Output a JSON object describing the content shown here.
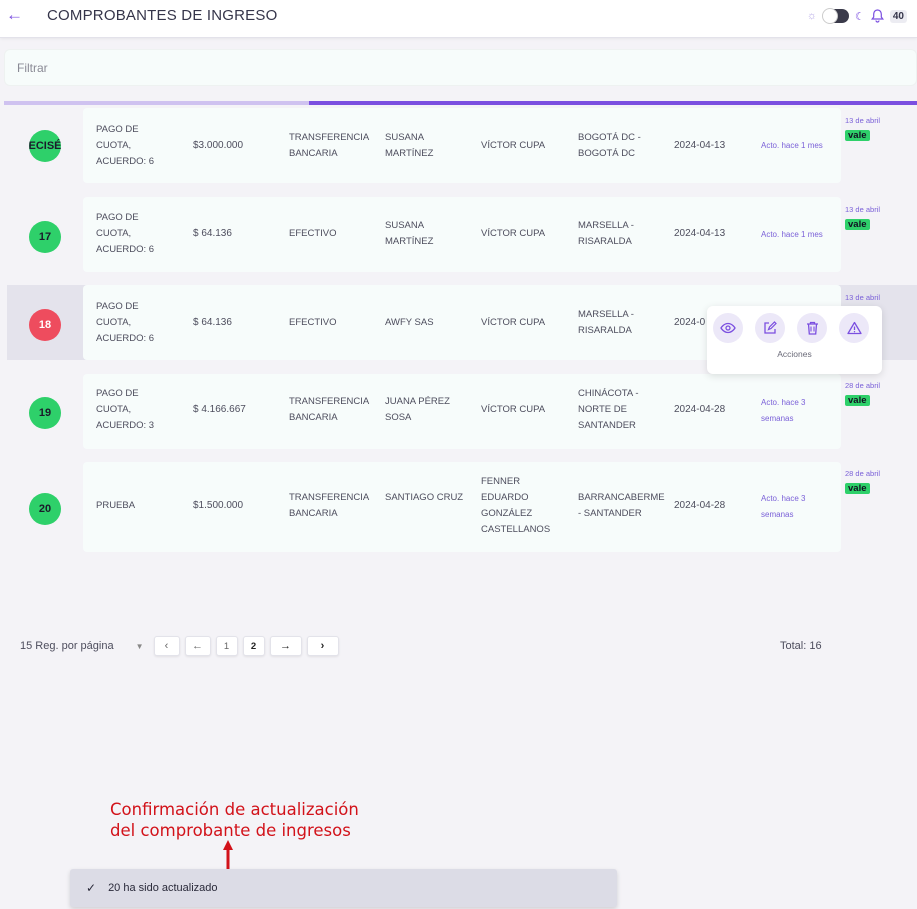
{
  "header": {
    "title": "COMPROBANTES DE INGRESO",
    "notifications": "40",
    "icons": [
      "back-arrow-icon",
      "sun-icon",
      "theme-toggle",
      "moon-icon",
      "bell-icon"
    ]
  },
  "filter": {
    "placeholder": "Filtrar"
  },
  "progress": {
    "value_percent": 67
  },
  "rows": [
    {
      "id": "ECISÉ",
      "status_color": "#2ed06a",
      "concept": "PAGO DE CUOTA, ACUERDO: 6",
      "amount": "$3.000.000",
      "method": "TRANSFERENCIA BANCARIA",
      "client": "SUSANA MARTÍNEZ",
      "collector": "VÍCTOR CUPA",
      "city": "BOGOTÁ DC - BOGOTÁ DC",
      "date": "2024-04-13",
      "updated": "Acto. hace 1 mes",
      "side_date": "13 de abril",
      "tag": "vale"
    },
    {
      "id": "17",
      "status_color": "#2ed06a",
      "concept": "PAGO DE CUOTA, ACUERDO: 6",
      "amount": "$ 64.136",
      "method": "EFECTIVO",
      "client": "SUSANA MARTÍNEZ",
      "collector": "VÍCTOR CUPA",
      "city": "MARSELLA - RISARALDA",
      "date": "2024-04-13",
      "updated": "Acto. hace 1 mes",
      "side_date": "13 de abril",
      "tag": "vale"
    },
    {
      "id": "18",
      "status_color": "#ee4c5e",
      "concept": "PAGO DE CUOTA, ACUERDO: 6",
      "amount": "$ 64.136",
      "method": "EFECTIVO",
      "client": "AWFY SAS",
      "collector": "VÍCTOR CUPA",
      "city": "MARSELLA - RISARALDA",
      "date": "2024-0",
      "updated": "",
      "side_date": "13 de abril",
      "tag": ""
    },
    {
      "id": "19",
      "status_color": "#2ed06a",
      "concept": "PAGO DE CUOTA, ACUERDO: 3",
      "amount": "$ 4.166.667",
      "method": "TRANSFERENCIA BANCARIA",
      "client": "JUANA PÉREZ SOSA",
      "collector": "VÍCTOR CUPA",
      "city": "CHINÁCOTA - NORTE DE SANTANDER",
      "date": "2024-04-28",
      "updated": "Acto. hace 3 semanas",
      "side_date": "28 de abril",
      "tag": "vale"
    },
    {
      "id": "20",
      "status_color": "#2ed06a",
      "concept": "PRUEBA",
      "amount": "$1.500.000",
      "method": "TRANSFERENCIA BANCARIA",
      "client": "SANTIAGO CRUZ",
      "collector": "FENNER EDUARDO GONZÁLEZ CASTELLANOS",
      "city": "BARRANCABERME - SANTANDER",
      "date": "2024-04-28",
      "updated": "Acto. hace 3 semanas",
      "side_date": "28 de abril",
      "tag": "vale"
    }
  ],
  "actions_popover": {
    "label": "Acciones",
    "buttons": [
      "eye-icon",
      "edit-icon",
      "trash-icon",
      "warning-icon"
    ]
  },
  "pagination": {
    "per_page_label": "15 Reg. por página",
    "pages": [
      "1",
      "2"
    ],
    "current_page": "2",
    "total": "Total: 16"
  },
  "annotation": {
    "line1": "Confirmación de actualización",
    "line2": "del comprobante de ingresos"
  },
  "toast": {
    "message": "20 ha sido actualizado"
  }
}
